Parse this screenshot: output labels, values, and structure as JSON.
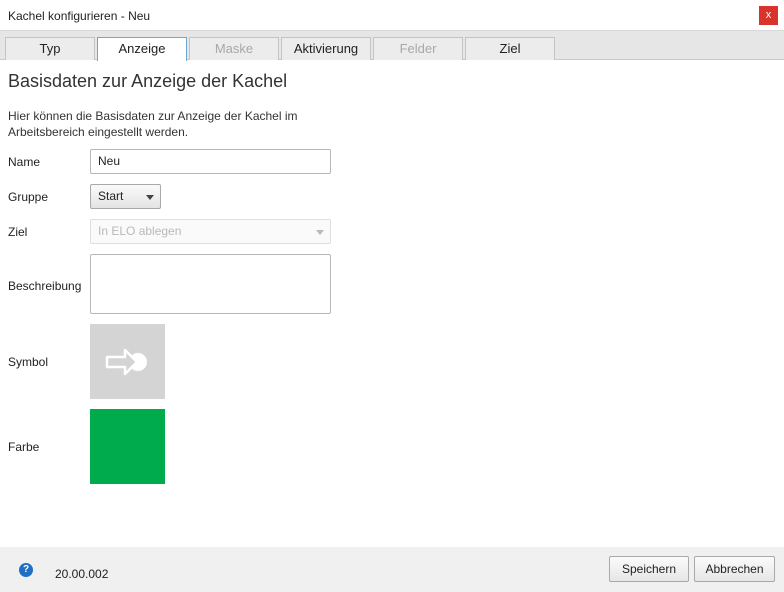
{
  "window": {
    "title": "Kachel konfigurieren - Neu",
    "close_label": "x"
  },
  "tabs": [
    {
      "label": "Typ",
      "state": "normal"
    },
    {
      "label": "Anzeige",
      "state": "active"
    },
    {
      "label": "Maske",
      "state": "disabled"
    },
    {
      "label": "Aktivierung",
      "state": "normal"
    },
    {
      "label": "Felder",
      "state": "disabled"
    },
    {
      "label": "Ziel",
      "state": "normal"
    }
  ],
  "content": {
    "heading": "Basisdaten zur Anzeige der Kachel",
    "description": "Hier können die Basisdaten zur Anzeige der Kachel im Arbeitsbereich eingestellt werden.",
    "fields": {
      "name": {
        "label": "Name",
        "value": "Neu"
      },
      "gruppe": {
        "label": "Gruppe",
        "value": "Start"
      },
      "ziel": {
        "label": "Ziel",
        "value": "In ELO ablegen"
      },
      "beschreibung": {
        "label": "Beschreibung",
        "value": ""
      },
      "symbol": {
        "label": "Symbol",
        "icon": "arrow-right-circle-icon",
        "tile_color": "#d4d4d4"
      },
      "farbe": {
        "label": "Farbe",
        "color": "#00ab4e"
      }
    }
  },
  "footer": {
    "help_glyph": "?",
    "version": "20.00.002",
    "save_label": "Speichern",
    "cancel_label": "Abbrechen"
  }
}
